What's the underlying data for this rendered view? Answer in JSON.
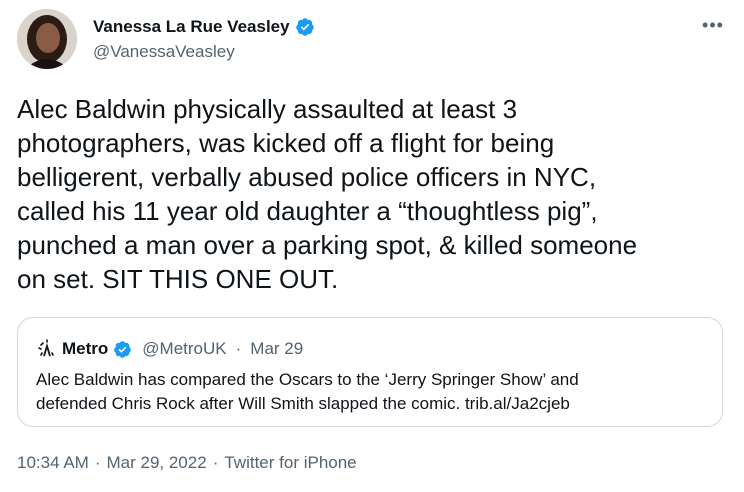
{
  "author": {
    "display_name": "Vanessa La Rue Veasley",
    "handle": "@VanessaVeasley",
    "verified_icon": "verified-badge-icon",
    "more_icon": "more-icon"
  },
  "tweet": {
    "lines": [
      "Alec Baldwin physically assaulted at least 3",
      "photographers, was kicked off a flight for being",
      "belligerent, verbally abused police officers in NYC,",
      "called his 11 year old daughter a “thoughtless pig”,",
      "punched a man over a parking spot, & killed someone",
      "on set. SIT THIS ONE OUT."
    ]
  },
  "quote": {
    "name": "Metro",
    "handle": "@MetroUK",
    "separator": "·",
    "date": "Mar 29",
    "lines": [
      "Alec Baldwin has compared the Oscars to the ‘Jerry Springer Show’ and",
      "defended Chris Rock after Will Smith slapped the comic. trib.al/Ja2cjeb"
    ]
  },
  "meta": {
    "time": "10:34 AM",
    "sep": "·",
    "date": "Mar 29, 2022",
    "source": "Twitter for iPhone"
  },
  "colors": {
    "text": "#0f1419",
    "secondary": "#536471",
    "verified": "#1d9bf0",
    "border": "#cfd9de"
  }
}
